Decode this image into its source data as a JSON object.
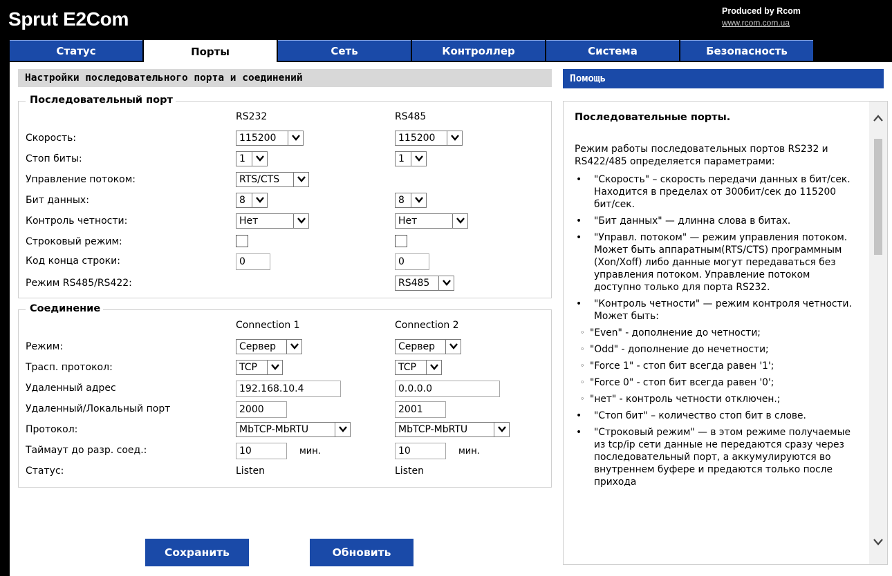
{
  "header": {
    "app_title": "Sprut E2Com",
    "produced_by": "Produced by Rcom",
    "site_link": "www.rcom.com.ua"
  },
  "tabs": [
    {
      "label": "Статус",
      "active": false
    },
    {
      "label": "Порты",
      "active": true
    },
    {
      "label": "Сеть",
      "active": false
    },
    {
      "label": "Контроллер",
      "active": false
    },
    {
      "label": "Система",
      "active": false
    },
    {
      "label": "Безопасность",
      "active": false
    }
  ],
  "main": {
    "section_title": "Настройки последовательного порта и соединений",
    "serial": {
      "legend": "Последовательный порт",
      "col1": "RS232",
      "col2": "RS485",
      "rows": {
        "speed": {
          "label": "Скорость:",
          "rs232": "115200",
          "rs485": "115200"
        },
        "stop_bits": {
          "label": "Стоп биты:",
          "rs232": "1",
          "rs485": "1"
        },
        "flow_control": {
          "label": "Управление потоком:",
          "rs232": "RTS/CTS"
        },
        "data_bits": {
          "label": "Бит данных:",
          "rs232": "8",
          "rs485": "8"
        },
        "parity": {
          "label": "Контроль четности:",
          "rs232": "Нет",
          "rs485": "Нет"
        },
        "line_mode": {
          "label": "Строковый режим:",
          "rs232": false,
          "rs485": false
        },
        "eol_code": {
          "label": "Код конца строки:",
          "rs232": "0",
          "rs485": "0"
        },
        "rs_mode": {
          "label": "Режим RS485/RS422:",
          "rs485": "RS485"
        }
      }
    },
    "connection": {
      "legend": "Соединение",
      "col1": "Connection 1",
      "col2": "Connection 2",
      "rows": {
        "mode": {
          "label": "Режим:",
          "c1": "Сервер",
          "c2": "Сервер"
        },
        "transport": {
          "label": "Трасп. протокол:",
          "c1": "TCP",
          "c2": "TCP"
        },
        "remote_addr": {
          "label": "Удаленный адрес",
          "c1": "192.168.10.4",
          "c2": "0.0.0.0"
        },
        "port": {
          "label": "Удаленный/Локальный порт",
          "c1": "2000",
          "c2": "2001"
        },
        "protocol": {
          "label": "Протокол:",
          "c1": "MbTCP-MbRTU",
          "c2": "MbTCP-MbRTU"
        },
        "timeout": {
          "label": "Таймаут до разр. соед.:",
          "c1": "10",
          "c2": "10",
          "unit": "мин."
        },
        "status": {
          "label": "Статус:",
          "c1": "Listen",
          "c2": "Listen"
        }
      }
    },
    "buttons": {
      "save": "Сохранить",
      "refresh": "Обновить"
    }
  },
  "help": {
    "bar_title": "Помощь",
    "title": "Последовательные порты.",
    "intro": "Режим работы последовательных портов RS232 и RS422/485 определяется параметрами:",
    "items": [
      "\"Скорость\" – скорость передачи данных в бит/сек. Находится в пределах от 300бит/сек до 115200 бит/сек.",
      "\"Бит данных\" — длинна слова в битах.",
      "\"Управл. потоком\" — режим управления потоком. Может быть аппаратным(RTS/CTS) программным (Xon/Xoff) либо данные могут передаваться без управления потоком. Управление потоком доступно только для порта RS232.",
      "\"Контроль четности\" — режим контроля четности. Может быть:",
      "\"Стоп бит\" – количество стоп бит в слове.",
      "\"Строковый режим\" — в этом режиме получаемые из tcp/ip сети данные не передаются сразу через последовательный порт, а аккумулируются во внутреннем буфере и предаются только после прихода"
    ],
    "parity_options": [
      "\"Even\" - дополнение до четности;",
      "\"Odd\" - дополнение до нечетности;",
      "\"Force 1\" - стоп бит всегда равен '1';",
      "\"Force 0\" - стоп бит всегда равен '0';",
      "\"нет\" - контроль четности отключен.;"
    ]
  },
  "colors": {
    "tab_blue": "#1a4aa8",
    "header_bg": "#000000",
    "section_bar": "#d8d8d8"
  }
}
